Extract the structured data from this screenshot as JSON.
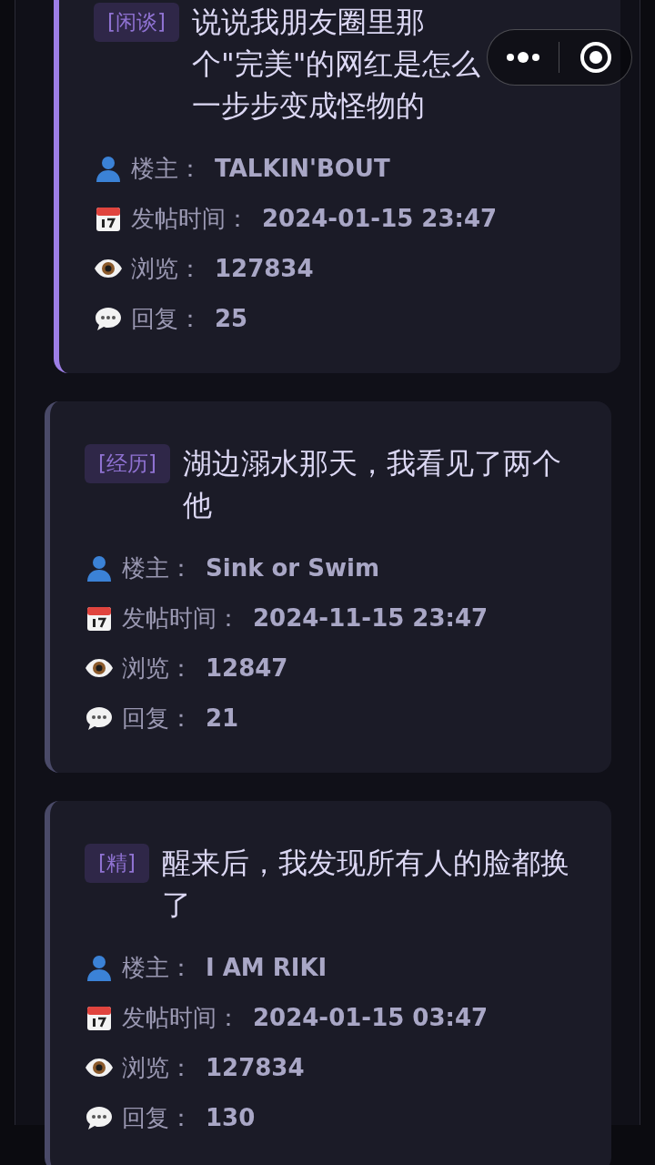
{
  "posts": [
    {
      "tag": "[闲谈]",
      "title": "说说我朋友圈里那个\"完美\"的网红是怎么一步步变成怪物的",
      "highlighted": true,
      "meta": [
        {
          "kind": "author",
          "label": "楼主：",
          "value": "TALKIN'BOUT"
        },
        {
          "kind": "date",
          "label": "发帖时间：",
          "value": "2024-01-15 23:47"
        },
        {
          "kind": "views",
          "label": "浏览：",
          "value": "127834"
        },
        {
          "kind": "replies",
          "label": "回复：",
          "value": "25"
        }
      ]
    },
    {
      "tag": "[经历]",
      "title": "湖边溺水那天，我看见了两个他",
      "highlighted": false,
      "meta": [
        {
          "kind": "author",
          "label": "楼主：",
          "value": "Sink or Swim"
        },
        {
          "kind": "date",
          "label": "发帖时间：",
          "value": "2024-11-15 23:47"
        },
        {
          "kind": "views",
          "label": "浏览：",
          "value": "12847"
        },
        {
          "kind": "replies",
          "label": "回复：",
          "value": "21"
        }
      ]
    },
    {
      "tag": "[精]",
      "title": "醒来后，我发现所有人的脸都换了",
      "highlighted": false,
      "meta": [
        {
          "kind": "author",
          "label": "楼主：",
          "value": "I AM RIKI"
        },
        {
          "kind": "date",
          "label": "发帖时间：",
          "value": "2024-01-15 03:47"
        },
        {
          "kind": "views",
          "label": "浏览：",
          "value": "127834"
        },
        {
          "kind": "replies",
          "label": "回复：",
          "value": "130"
        }
      ]
    }
  ]
}
